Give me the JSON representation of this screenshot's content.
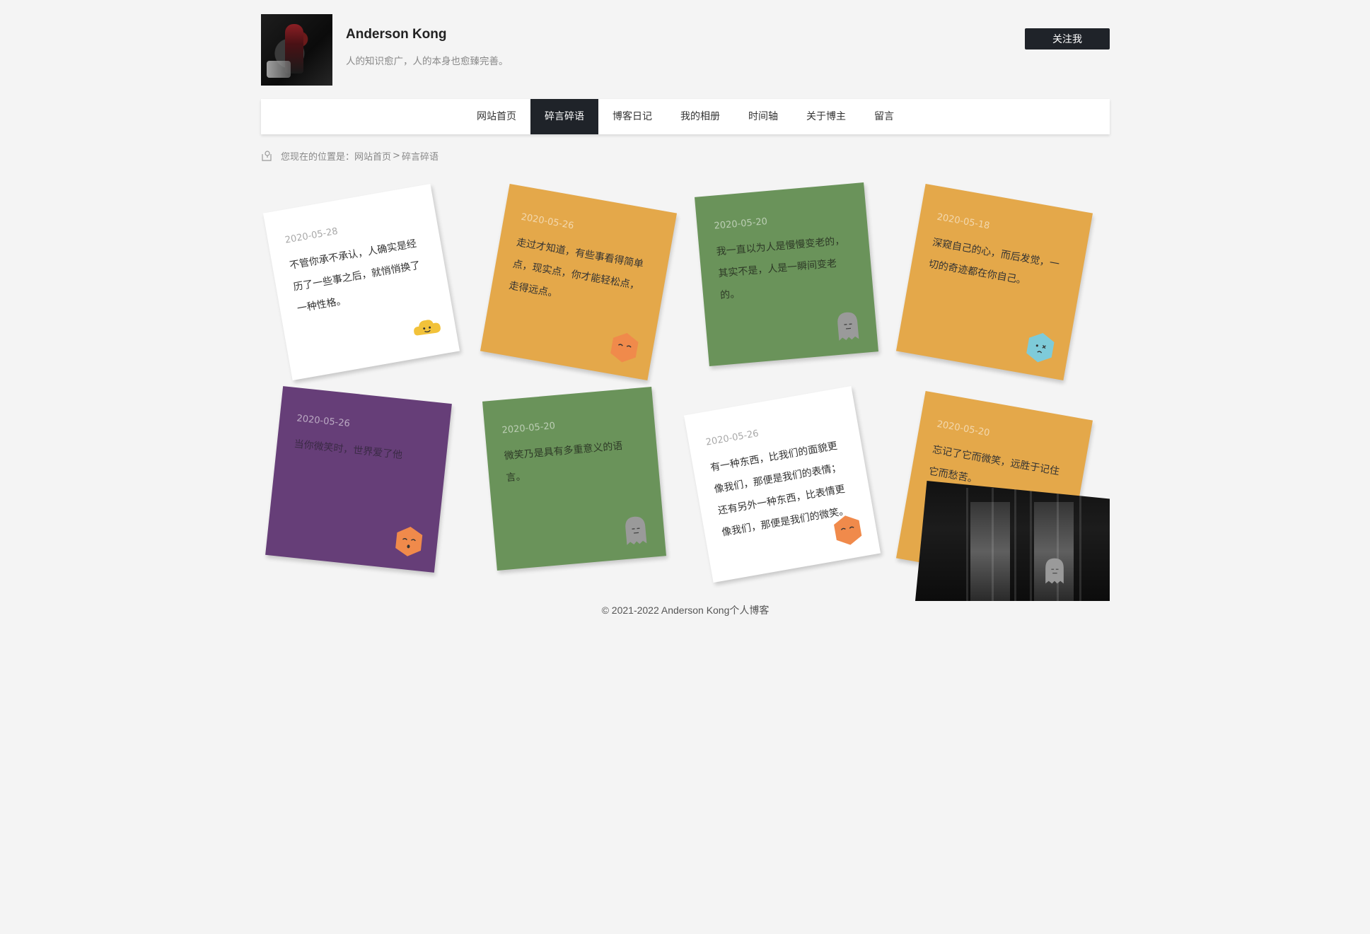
{
  "header": {
    "name": "Anderson Kong",
    "motto": "人的知识愈广，人的本身也愈臻完善。",
    "follow_label": "关注我"
  },
  "nav": {
    "items": [
      {
        "label": "网站首页"
      },
      {
        "label": "碎言碎语",
        "active": true
      },
      {
        "label": "博客日记"
      },
      {
        "label": "我的相册"
      },
      {
        "label": "时间轴"
      },
      {
        "label": "关于博主"
      },
      {
        "label": "留言"
      }
    ]
  },
  "breadcrumb": {
    "prefix": "您现在的位置是：",
    "home": "网站首页",
    "separator": ">",
    "current": "碎言碎语"
  },
  "notes": [
    {
      "date": "2020-05-28",
      "text": "不管你承不承认，人确实是经历了一些事之后，就悄悄换了一种性格。",
      "color": "#ffffff",
      "face": "cloud-smile-icon"
    },
    {
      "date": "2020-05-26",
      "text": "走过才知道，有些事看得简单点，现实点，你才能轻松点，走得远点。",
      "color": "#e4a84a",
      "face": "hexagon-sleepy-icon"
    },
    {
      "date": "2020-05-20",
      "text": "我一直以为人是慢慢变老的，其实不是，人是一瞬间变老的。",
      "color": "#6a935a",
      "face": "ghost-icon"
    },
    {
      "date": "2020-05-18",
      "text": "深窥自己的心，而后发觉，一切的奇迹都在你自己。",
      "color": "#e4a84a",
      "face": "hexagon-cry-icon"
    },
    {
      "date": "2020-05-26",
      "text": "当你微笑时，世界爱了他",
      "color": "#663e78",
      "face": "hexagon-sleepy-icon"
    },
    {
      "date": "2020-05-20",
      "text": "微笑乃是具有多重意义的语言。",
      "color": "#6a935a",
      "face": "ghost-icon"
    },
    {
      "date": "2020-05-26",
      "text": "有一种东西，比我们的面貌更像我们，那便是我们的表情；还有另外一种东西，比表情更像我们，那便是我们的微笑。",
      "color": "#ffffff",
      "face": "hexagon-sleepy-icon"
    },
    {
      "date": "2020-05-20",
      "text": "忘记了它而微笑，远胜于记住它而愁苦。",
      "color": "#e4a84a",
      "face": "ghost-icon"
    }
  ],
  "footer": {
    "text": "© 2021-2022 Anderson Kong个人博客"
  }
}
